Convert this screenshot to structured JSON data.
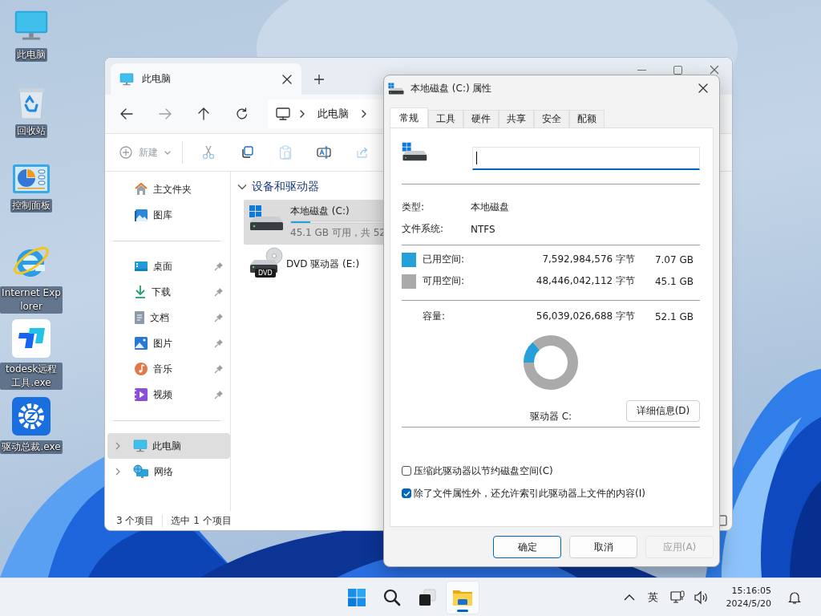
{
  "desktop_icons": [
    {
      "label": "此电脑"
    },
    {
      "label": "回收站"
    },
    {
      "label": "控制面板"
    },
    {
      "label": "Internet Explorer"
    },
    {
      "label": "todesk远程工具.exe"
    },
    {
      "label": "驱动总裁.exe"
    }
  ],
  "explorer": {
    "tabs": [
      {
        "title": "此电脑",
        "selected": true
      }
    ],
    "address": {
      "crumbs": [
        "此电脑"
      ]
    },
    "command_bar": {
      "new_label": "新建"
    },
    "sidebar": {
      "sections": [
        {
          "items": [
            {
              "label": "主文件夹",
              "selected": false
            },
            {
              "label": "图库",
              "selected": false
            }
          ]
        },
        {
          "items": [
            {
              "label": "桌面",
              "pinned": true,
              "selected": false
            },
            {
              "label": "下载",
              "pinned": true,
              "selected": false
            },
            {
              "label": "文档",
              "pinned": true,
              "selected": false
            },
            {
              "label": "图片",
              "pinned": true,
              "selected": false
            },
            {
              "label": "音乐",
              "pinned": true,
              "selected": false
            },
            {
              "label": "视频",
              "pinned": true,
              "selected": false
            }
          ]
        },
        {
          "items": [
            {
              "label": "此电脑",
              "expanded": false,
              "selected": true
            },
            {
              "label": "网络",
              "expanded": false,
              "selected": false
            }
          ]
        }
      ]
    },
    "section": {
      "title": "设备和驱动器",
      "expanded": true
    },
    "drives": [
      {
        "kind": "disk",
        "name": "本地磁盘 (C:)",
        "level": 0.136,
        "space": "45.1 GB 可用，共 52",
        "selected": true
      },
      {
        "kind": "optical",
        "name": "DVD 驱动器 (E:)",
        "icon_label": "DVD",
        "selected": false
      }
    ],
    "status_bar": {
      "count": "3 个项目",
      "selection": "选中 1 个项目"
    }
  },
  "properties": {
    "title": "本地磁盘 (C:) 属性",
    "tabs": [
      {
        "label": "常规",
        "selected": true
      },
      {
        "label": "工具",
        "selected": false
      },
      {
        "label": "硬件",
        "selected": false
      },
      {
        "label": "共享",
        "selected": false
      },
      {
        "label": "安全",
        "selected": false
      },
      {
        "label": "配额",
        "selected": false
      }
    ],
    "name_field": {
      "focused": true
    },
    "info": [
      {
        "label": "类型:",
        "value": "本地磁盘"
      },
      {
        "label": "文件系统:",
        "value": "NTFS"
      }
    ],
    "space": [
      {
        "label": "已用空间:",
        "bytes": "7,592,984,576 字节",
        "size": "7.07 GB",
        "color": "#26a0da"
      },
      {
        "label": "可用空间:",
        "bytes": "48,446,042,112 字节",
        "size": "45.1 GB",
        "color": "#aaaaaa"
      }
    ],
    "capacity": {
      "label": "容量:",
      "bytes": "56,039,026,688 字节",
      "size": "52.1 GB"
    },
    "drive_label": "驱动器 C:",
    "details_button": "详细信息(D)",
    "options": [
      {
        "label": "压缩此驱动器以节约磁盘空间(C)",
        "checked": false
      },
      {
        "label": "除了文件属性外，还允许索引此驱动器上文件的内容(I)",
        "checked": true
      }
    ],
    "buttons": [
      {
        "label": "确定",
        "default": true,
        "disabled": false
      },
      {
        "label": "取消",
        "default": false,
        "disabled": false
      },
      {
        "label": "应用(A)",
        "default": false,
        "disabled": true
      }
    ]
  },
  "taskbar": {
    "apps": [
      {
        "active": true
      }
    ],
    "input_method": "英",
    "time": "15:16:05",
    "date": "2024/5/20"
  }
}
